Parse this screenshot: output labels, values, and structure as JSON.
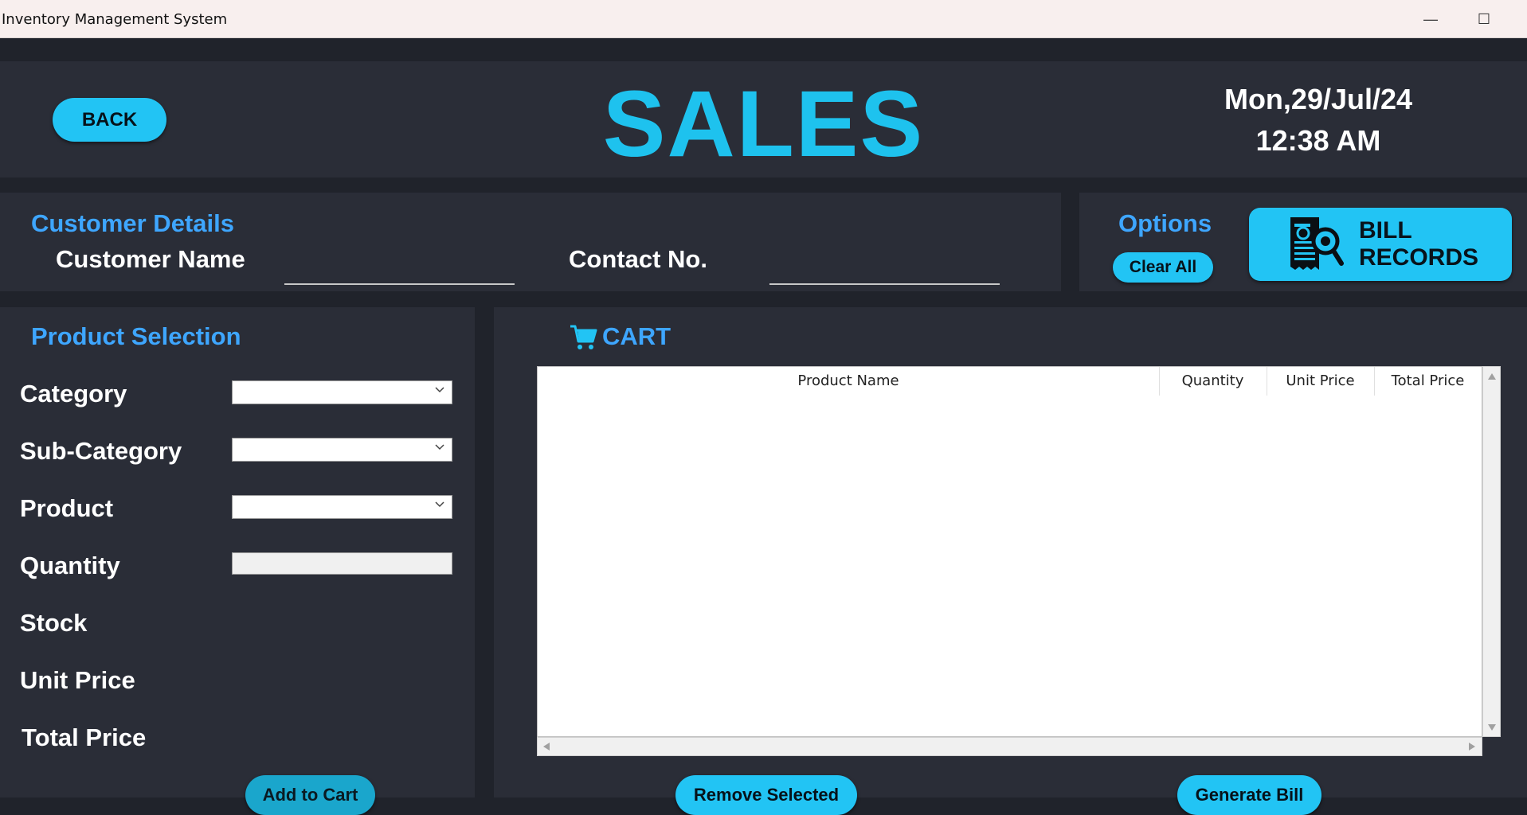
{
  "window": {
    "title": "Inventory Management System",
    "minimize_glyph": "—",
    "maximize_glyph": "☐"
  },
  "header": {
    "back_label": "BACK",
    "title": "SALES",
    "date": "Mon,29/Jul/24",
    "time": "12:38 AM"
  },
  "customer": {
    "heading": "Customer Details",
    "name_label": "Customer Name",
    "name_value": "",
    "contact_label": "Contact No.",
    "contact_value": ""
  },
  "options": {
    "heading": "Options",
    "clear_all_label": "Clear All",
    "bill_records_line1": "BILL",
    "bill_records_line2": "RECORDS"
  },
  "product_selection": {
    "heading": "Product Selection",
    "category_label": "Category",
    "subcategory_label": "Sub-Category",
    "product_label": "Product",
    "quantity_label": "Quantity",
    "stock_label": "Stock",
    "unit_price_label": "Unit Price",
    "total_price_label": "Total Price",
    "add_to_cart_label": "Add to Cart"
  },
  "cart": {
    "heading": "CART",
    "columns": [
      "Product Name",
      "Quantity",
      "Unit Price",
      "Total Price"
    ],
    "rows": [],
    "remove_label": "Remove Selected",
    "generate_label": "Generate Bill"
  },
  "colors": {
    "accent": "#22c4f4",
    "heading_blue": "#3ea6ff",
    "panel": "#2a2d37",
    "background": "#20232b"
  }
}
